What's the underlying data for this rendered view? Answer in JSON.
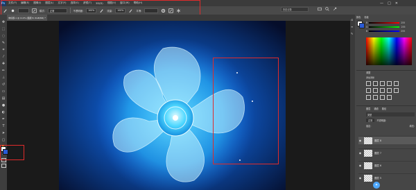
{
  "menubar": {
    "logo": "Ps",
    "items": [
      "文件(F)",
      "编辑(E)",
      "图像(I)",
      "图层(L)",
      "文字(Y)",
      "选择(S)",
      "滤镜(T)",
      "3D(D)",
      "视图(V)",
      "窗口(W)",
      "帮助(H)"
    ],
    "window_controls": [
      "—",
      "□",
      "✕"
    ]
  },
  "options": {
    "mode_label": "模式:",
    "mode_value": "正常",
    "opacity_label": "不透明度:",
    "opacity_value": "100%",
    "flow_label": "流量:",
    "flow_value": "100%",
    "smooth_label": "平滑:"
  },
  "search": {
    "placeholder": "历史记录"
  },
  "document": {
    "tab_title": "未标题-1 @ 112% (图层 8, RGB/8#) *"
  },
  "panels": {
    "color_tabs": [
      "颜色",
      "色板"
    ],
    "channels": [
      {
        "label": "R",
        "value": "255"
      },
      {
        "label": "G",
        "value": "255"
      },
      {
        "label": "B",
        "value": "255"
      }
    ],
    "adjust_tabs": [
      "调整"
    ],
    "adjust_subtitle": "添加调整",
    "layers_tabs": [
      "图层",
      "通道",
      "路径"
    ],
    "kind_label": "类型",
    "blend_mode": "正常",
    "opacity_label": "不透明度:",
    "lock_label": "锁定:",
    "fill_label": "填充:",
    "layers": [
      {
        "name": "图层 8"
      },
      {
        "name": "图层 7"
      },
      {
        "name": "图层 6"
      },
      {
        "name": "图层 5"
      }
    ]
  },
  "colors": {
    "accent_red": "#e02b2b",
    "fan_cyan": "#3fd0ff",
    "foreground": "#ffffff",
    "background": "#2a5bd7"
  }
}
